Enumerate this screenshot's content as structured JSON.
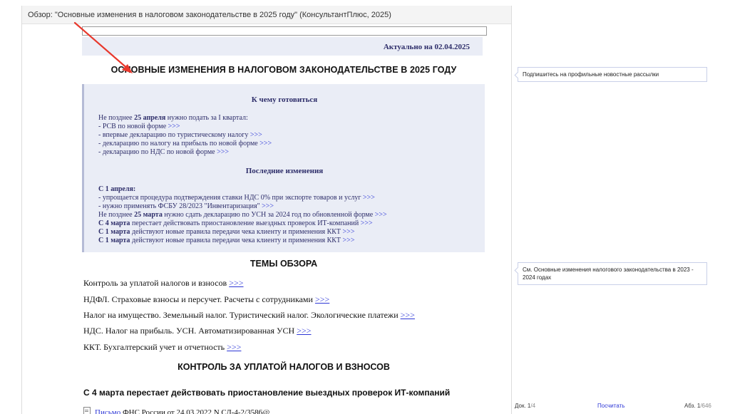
{
  "header": {
    "title": "Обзор: \"Основные изменения в налоговом законодательстве в 2025 году\" (КонсультантПлюс, 2025)"
  },
  "actual_date": "Актуально на 02.04.2025",
  "main_title": "ОСНОВНЫЕ ИЗМЕНЕНИЯ В НАЛОГОВОМ ЗАКОНОДАТЕЛЬСТВЕ В 2025 ГОДУ",
  "link_marker": ">>>",
  "prepare": {
    "heading": "К чему готовиться",
    "intro_prefix": "Не позднее ",
    "intro_bold": "25 апреля",
    "intro_suffix": " нужно подать за I квартал:",
    "items": [
      "- РСВ по новой форме ",
      "- впервые декларацию по туристическому налогу ",
      "- декларацию по налогу на прибыль по новой форме ",
      "- декларацию по НДС по новой форме "
    ]
  },
  "latest": {
    "heading": "Последние изменения",
    "april_bold": "С 1 апреля:",
    "april_items": [
      "- упрощается процедура подтверждения ставки НДС 0% при экспорте товаров и услуг ",
      "- нужно применять ФСБУ 28/2023 \"Инвентаризация\" "
    ],
    "usn_prefix": "Не позднее ",
    "usn_bold": "25 марта",
    "usn_suffix": " нужно сдать декларацию по УСН за 2024 год по обновленной форме ",
    "march4_bold": "С 4 марта",
    "march4_rest": " перестает действовать приостановление выездных проверок ИТ-компаний ",
    "march1_bold": "С 1 марта",
    "march1_rest": " действуют новые правила передачи чека клиенту и применения ККТ "
  },
  "topics_title": "ТЕМЫ ОБЗОРА",
  "topics": [
    "Контроль за уплатой налогов и взносов ",
    "НДФЛ. Страховые взносы и персучет. Расчеты с сотрудниками ",
    "Налог на имущество. Земельный налог. Туристический налог. Экологические платежи ",
    "НДС. Налог на прибыль. УСН. Автоматизированная УСН ",
    "ККТ. Бухгалтерский учет и отчетность "
  ],
  "section_title": "КОНТРОЛЬ ЗА УПЛАТОЙ НАЛОГОВ И ВЗНОСОВ",
  "subsection_title": "С 4 марта перестает действовать приостановление выездных проверок ИТ-компаний",
  "letter": {
    "link": "Письмо",
    "rest": " ФНС России от 24.03.2022 N СД-4-2/3586@"
  },
  "notes": {
    "subscribe": "Подпишитесь на профильные новостные рассылки",
    "see_also": "См. Основные изменения налогового законодательства в 2023 - 2024 годах"
  },
  "status": {
    "doc_label": "Док. 1",
    "doc_total": "/4",
    "count_button": "Посчитать",
    "par_label": "Абз. 1",
    "par_total": "/646"
  },
  "colors": {
    "box_bg": "#eaedf6",
    "box_text": "#2e2e6a",
    "link": "#2c36d6",
    "arrow": "#e8382c"
  }
}
